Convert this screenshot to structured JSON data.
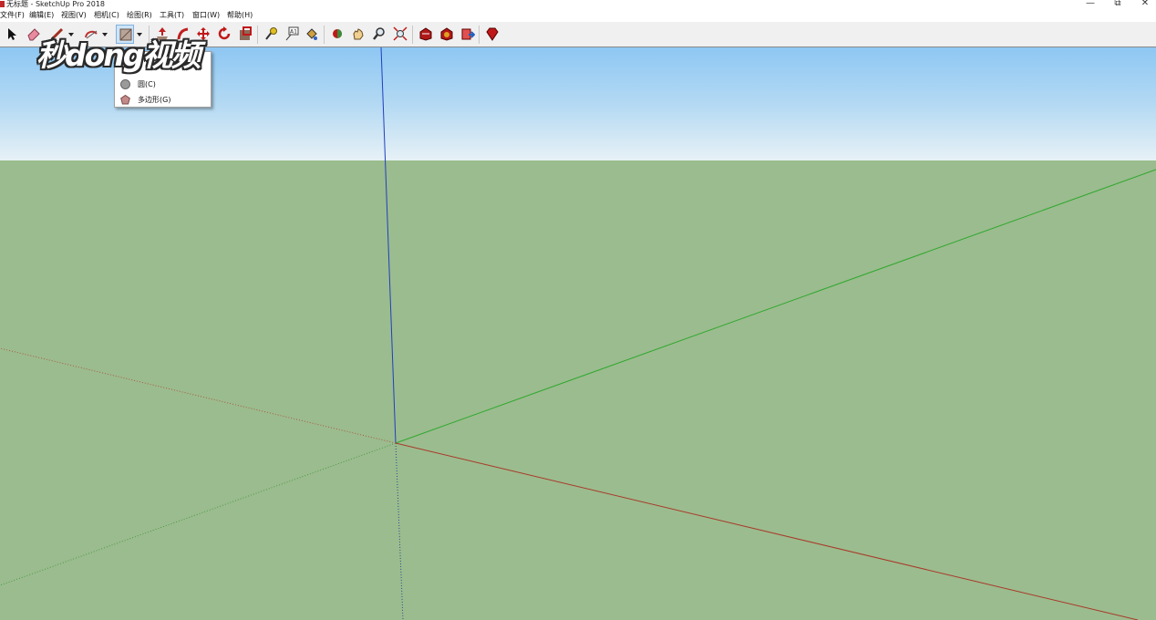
{
  "window": {
    "title": "无标题 - SketchUp Pro 2018",
    "controls": {
      "minimize": "—",
      "restore": "⧉",
      "close": "✕"
    }
  },
  "menubar": {
    "items": [
      {
        "label": "文件(F)"
      },
      {
        "label": "编辑(E)"
      },
      {
        "label": "视图(V)"
      },
      {
        "label": "相机(C)"
      },
      {
        "label": "绘图(R)"
      },
      {
        "label": "工具(T)"
      },
      {
        "label": "窗口(W)"
      },
      {
        "label": "帮助(H)"
      }
    ]
  },
  "toolbar": {
    "tools": [
      {
        "icon": "select-arrow-icon"
      },
      {
        "icon": "eraser-icon"
      },
      {
        "icon": "pencil-line-icon"
      },
      {
        "icon": "arc-icon"
      },
      {
        "icon": "rectangle-icon",
        "active": true
      },
      {
        "icon": "push-pull-icon"
      },
      {
        "icon": "follow-me-icon"
      },
      {
        "icon": "move-icon"
      },
      {
        "icon": "rotate-icon"
      },
      {
        "icon": "offset-icon"
      },
      {
        "icon": "tape-measure-icon"
      },
      {
        "icon": "text-icon"
      },
      {
        "icon": "paint-bucket-icon"
      },
      {
        "icon": "orbit-icon"
      },
      {
        "icon": "pan-hand-icon"
      },
      {
        "icon": "zoom-icon"
      },
      {
        "icon": "zoom-extents-icon"
      },
      {
        "icon": "warehouse-icon"
      },
      {
        "icon": "extension-warehouse-icon"
      },
      {
        "icon": "send-to-layout-icon"
      },
      {
        "icon": "ruby-icon"
      }
    ],
    "text_tool_glyph": "A1"
  },
  "shape_dropdown": {
    "items": [
      {
        "label": "圆(C)",
        "icon": "circle-shape-icon",
        "color": "#9a9a9a"
      },
      {
        "label": "多边形(G)",
        "icon": "polygon-shape-icon",
        "color": "#c48a8a"
      }
    ]
  },
  "watermark": {
    "text": "秒dong视频"
  },
  "colors": {
    "sky_top": "#8ec7f3",
    "ground": "#9bbc8e",
    "axis_blue": "#1f3fbf",
    "axis_green": "#2ea82e",
    "axis_red": "#a83a2a"
  }
}
